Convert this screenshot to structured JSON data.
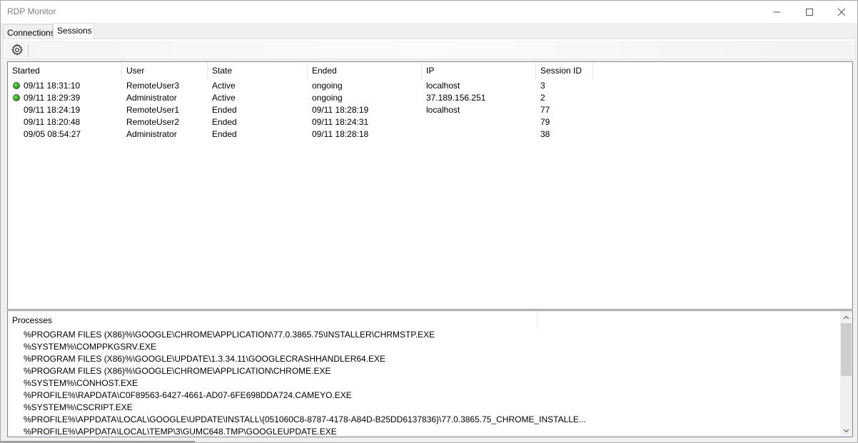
{
  "window": {
    "title": "RDP Monitor"
  },
  "tabs": [
    {
      "label": "Connections",
      "active": false
    },
    {
      "label": "Sessions",
      "active": true
    }
  ],
  "toolbar": {
    "settings_icon": "gear-icon"
  },
  "sessions": {
    "columns": [
      "Started",
      "User",
      "State",
      "Ended",
      "IP",
      "Session ID"
    ],
    "rows": [
      {
        "status_icon": true,
        "started": "09/11 18:31:10",
        "user": "RemoteUser3",
        "state": "Active",
        "ended": "ongoing",
        "ip": "localhost",
        "session_id": "3"
      },
      {
        "status_icon": true,
        "started": "09/11 18:29:39",
        "user": "Administrator",
        "state": "Active",
        "ended": "ongoing",
        "ip": "37.189.156.251",
        "session_id": "2"
      },
      {
        "status_icon": false,
        "started": "09/11 18:24:19",
        "user": "RemoteUser1",
        "state": "Ended",
        "ended": "09/11 18:28:19",
        "ip": "localhost",
        "session_id": "77"
      },
      {
        "status_icon": false,
        "started": "09/11 18:20:48",
        "user": "RemoteUser2",
        "state": "Ended",
        "ended": "09/11 18:24:31",
        "ip": "",
        "session_id": "79"
      },
      {
        "status_icon": false,
        "started": "09/05 08:54:27",
        "user": "Administrator",
        "state": "Ended",
        "ended": "09/11 18:28:18",
        "ip": "",
        "session_id": "38"
      }
    ]
  },
  "processes": {
    "header": "Processes",
    "items": [
      "%PROGRAM FILES (X86)%\\GOOGLE\\CHROME\\APPLICATION\\77.0.3865.75\\INSTALLER\\CHRMSTP.EXE",
      "%SYSTEM%\\COMPPKGSRV.EXE",
      "%PROGRAM FILES (X86)%\\GOOGLE\\UPDATE\\1.3.34.11\\GOOGLECRASHHANDLER64.EXE",
      "%PROGRAM FILES (X86)%\\GOOGLE\\CHROME\\APPLICATION\\CHROME.EXE",
      "%SYSTEM%\\CONHOST.EXE",
      "%PROFILE%\\RAPDATA\\C0F89563-6427-4661-AD07-6FE698DDA724.CAMEYO.EXE",
      "%SYSTEM%\\CSCRIPT.EXE",
      "%PROFILE%\\APPDATA\\LOCAL\\GOOGLE\\UPDATE\\INSTALL\\{051060C8-8787-4178-A84D-B25DD6137836}\\77.0.3865.75_CHROME_INSTALLE...",
      "%PROFILE%\\APPDATA\\LOCAL\\TEMP\\3\\GUMC648.TMP\\GOOGLEUPDATE.EXE"
    ]
  },
  "colors": {
    "active_status": "#3aa52d",
    "list_border": "#828790",
    "window_bg": "#f0f0f0"
  }
}
